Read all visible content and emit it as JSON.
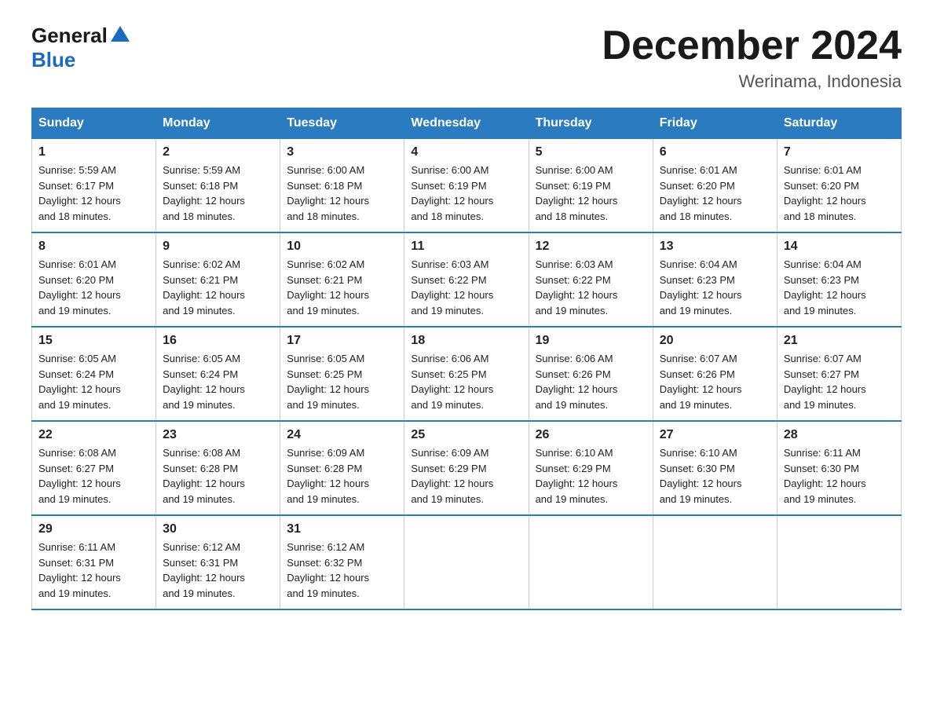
{
  "header": {
    "logo_general": "General",
    "logo_blue": "Blue",
    "month_title": "December 2024",
    "location": "Werinama, Indonesia"
  },
  "days_of_week": [
    "Sunday",
    "Monday",
    "Tuesday",
    "Wednesday",
    "Thursday",
    "Friday",
    "Saturday"
  ],
  "weeks": [
    [
      {
        "num": "1",
        "sunrise": "5:59 AM",
        "sunset": "6:17 PM",
        "daylight": "12 hours and 18 minutes."
      },
      {
        "num": "2",
        "sunrise": "5:59 AM",
        "sunset": "6:18 PM",
        "daylight": "12 hours and 18 minutes."
      },
      {
        "num": "3",
        "sunrise": "6:00 AM",
        "sunset": "6:18 PM",
        "daylight": "12 hours and 18 minutes."
      },
      {
        "num": "4",
        "sunrise": "6:00 AM",
        "sunset": "6:19 PM",
        "daylight": "12 hours and 18 minutes."
      },
      {
        "num": "5",
        "sunrise": "6:00 AM",
        "sunset": "6:19 PM",
        "daylight": "12 hours and 18 minutes."
      },
      {
        "num": "6",
        "sunrise": "6:01 AM",
        "sunset": "6:20 PM",
        "daylight": "12 hours and 18 minutes."
      },
      {
        "num": "7",
        "sunrise": "6:01 AM",
        "sunset": "6:20 PM",
        "daylight": "12 hours and 18 minutes."
      }
    ],
    [
      {
        "num": "8",
        "sunrise": "6:01 AM",
        "sunset": "6:20 PM",
        "daylight": "12 hours and 19 minutes."
      },
      {
        "num": "9",
        "sunrise": "6:02 AM",
        "sunset": "6:21 PM",
        "daylight": "12 hours and 19 minutes."
      },
      {
        "num": "10",
        "sunrise": "6:02 AM",
        "sunset": "6:21 PM",
        "daylight": "12 hours and 19 minutes."
      },
      {
        "num": "11",
        "sunrise": "6:03 AM",
        "sunset": "6:22 PM",
        "daylight": "12 hours and 19 minutes."
      },
      {
        "num": "12",
        "sunrise": "6:03 AM",
        "sunset": "6:22 PM",
        "daylight": "12 hours and 19 minutes."
      },
      {
        "num": "13",
        "sunrise": "6:04 AM",
        "sunset": "6:23 PM",
        "daylight": "12 hours and 19 minutes."
      },
      {
        "num": "14",
        "sunrise": "6:04 AM",
        "sunset": "6:23 PM",
        "daylight": "12 hours and 19 minutes."
      }
    ],
    [
      {
        "num": "15",
        "sunrise": "6:05 AM",
        "sunset": "6:24 PM",
        "daylight": "12 hours and 19 minutes."
      },
      {
        "num": "16",
        "sunrise": "6:05 AM",
        "sunset": "6:24 PM",
        "daylight": "12 hours and 19 minutes."
      },
      {
        "num": "17",
        "sunrise": "6:05 AM",
        "sunset": "6:25 PM",
        "daylight": "12 hours and 19 minutes."
      },
      {
        "num": "18",
        "sunrise": "6:06 AM",
        "sunset": "6:25 PM",
        "daylight": "12 hours and 19 minutes."
      },
      {
        "num": "19",
        "sunrise": "6:06 AM",
        "sunset": "6:26 PM",
        "daylight": "12 hours and 19 minutes."
      },
      {
        "num": "20",
        "sunrise": "6:07 AM",
        "sunset": "6:26 PM",
        "daylight": "12 hours and 19 minutes."
      },
      {
        "num": "21",
        "sunrise": "6:07 AM",
        "sunset": "6:27 PM",
        "daylight": "12 hours and 19 minutes."
      }
    ],
    [
      {
        "num": "22",
        "sunrise": "6:08 AM",
        "sunset": "6:27 PM",
        "daylight": "12 hours and 19 minutes."
      },
      {
        "num": "23",
        "sunrise": "6:08 AM",
        "sunset": "6:28 PM",
        "daylight": "12 hours and 19 minutes."
      },
      {
        "num": "24",
        "sunrise": "6:09 AM",
        "sunset": "6:28 PM",
        "daylight": "12 hours and 19 minutes."
      },
      {
        "num": "25",
        "sunrise": "6:09 AM",
        "sunset": "6:29 PM",
        "daylight": "12 hours and 19 minutes."
      },
      {
        "num": "26",
        "sunrise": "6:10 AM",
        "sunset": "6:29 PM",
        "daylight": "12 hours and 19 minutes."
      },
      {
        "num": "27",
        "sunrise": "6:10 AM",
        "sunset": "6:30 PM",
        "daylight": "12 hours and 19 minutes."
      },
      {
        "num": "28",
        "sunrise": "6:11 AM",
        "sunset": "6:30 PM",
        "daylight": "12 hours and 19 minutes."
      }
    ],
    [
      {
        "num": "29",
        "sunrise": "6:11 AM",
        "sunset": "6:31 PM",
        "daylight": "12 hours and 19 minutes."
      },
      {
        "num": "30",
        "sunrise": "6:12 AM",
        "sunset": "6:31 PM",
        "daylight": "12 hours and 19 minutes."
      },
      {
        "num": "31",
        "sunrise": "6:12 AM",
        "sunset": "6:32 PM",
        "daylight": "12 hours and 19 minutes."
      },
      null,
      null,
      null,
      null
    ]
  ]
}
